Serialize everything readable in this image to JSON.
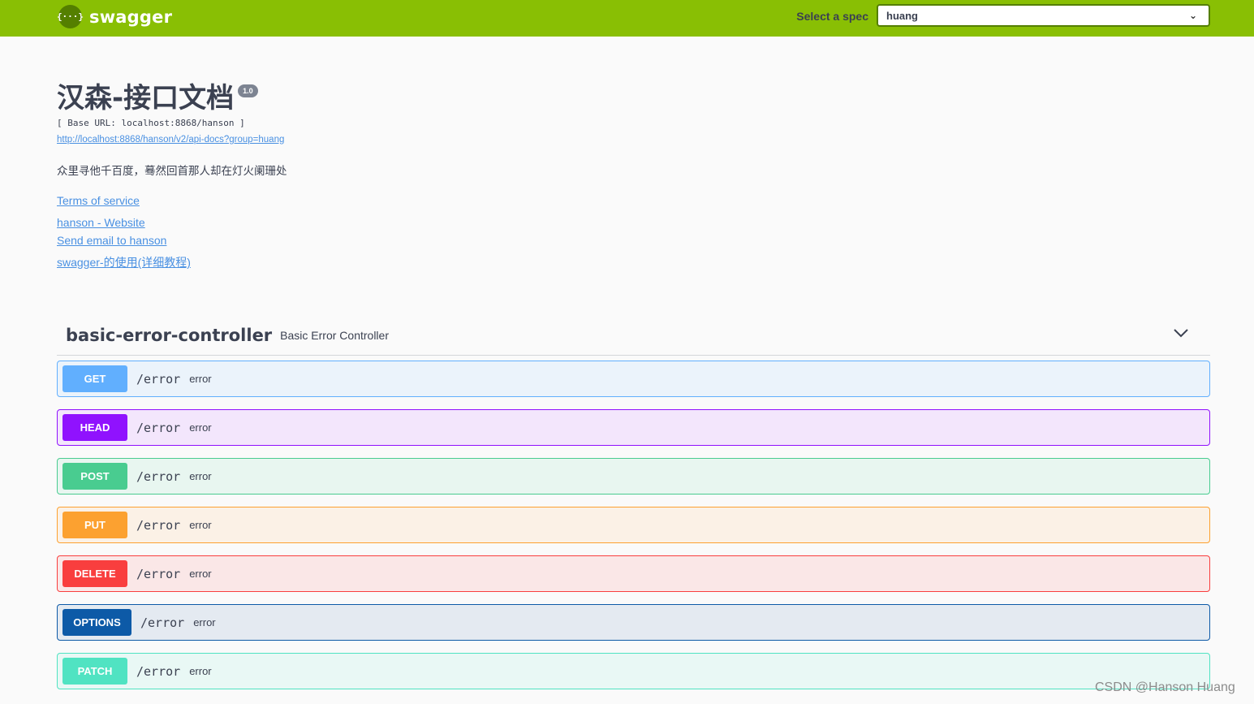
{
  "topbar": {
    "logo_icon": "{···}",
    "logo_text": "swagger",
    "spec_label": "Select a spec",
    "spec_selected": "huang",
    "accent_color": "#89bf04"
  },
  "info": {
    "title": "汉森-接口文档",
    "version": "1.0",
    "base_url": "[ Base URL: localhost:8868/hanson ]",
    "spec_url": "http://localhost:8868/hanson/v2/api-docs?group=huang",
    "description": "众里寻他千百度，蓦然回首那人却在灯火阑珊处",
    "links": {
      "terms": "Terms of service",
      "website": "hanson - Website",
      "email": "Send email to hanson",
      "docs": "swagger-的使用(详细教程)"
    }
  },
  "section": {
    "name": "basic-error-controller",
    "description": "Basic Error Controller",
    "toggle_icon": "chevron-down-icon"
  },
  "operations": [
    {
      "method": "GET",
      "path": "/error",
      "summary": "error",
      "color": "#61affe",
      "bg": "#ebf3fb"
    },
    {
      "method": "HEAD",
      "path": "/error",
      "summary": "error",
      "color": "#9012fe",
      "bg": "#f3e6fc"
    },
    {
      "method": "POST",
      "path": "/error",
      "summary": "error",
      "color": "#49cc90",
      "bg": "#e8f6f0"
    },
    {
      "method": "PUT",
      "path": "/error",
      "summary": "error",
      "color": "#fca130",
      "bg": "#fbf1e6"
    },
    {
      "method": "DELETE",
      "path": "/error",
      "summary": "error",
      "color": "#f93e3e",
      "bg": "#fae7e7"
    },
    {
      "method": "OPTIONS",
      "path": "/error",
      "summary": "error",
      "color": "#0d5aa7",
      "bg": "#e4eaf1"
    },
    {
      "method": "PATCH",
      "path": "/error",
      "summary": "error",
      "color": "#50e3c2",
      "bg": "#e9f8f5"
    }
  ],
  "watermark": "CSDN @Hanson Huang"
}
